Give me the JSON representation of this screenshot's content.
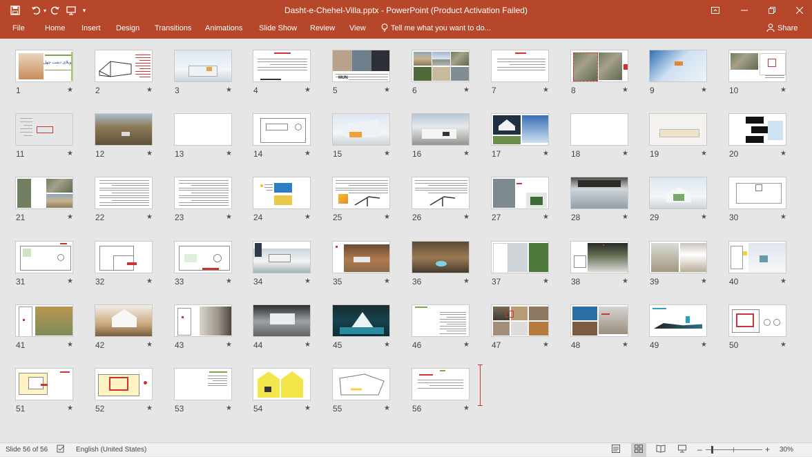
{
  "window": {
    "title": "Dasht-e-Chehel-Villa.pptx - PowerPoint (Product Activation Failed)",
    "accent": "#b7472a"
  },
  "qat": {
    "icons": [
      "save-icon",
      "undo-icon",
      "redo-icon",
      "start-from-beginning-icon",
      "customize-qat-icon"
    ]
  },
  "ribbon": {
    "tabs": [
      "File",
      "Home",
      "Insert",
      "Design",
      "Transitions",
      "Animations",
      "Slide Show",
      "Review",
      "View"
    ],
    "tell_me": "Tell me what you want to do...",
    "share": "Share"
  },
  "slides": {
    "items": [
      {
        "n": "1",
        "star": "★"
      },
      {
        "n": "2",
        "star": "★"
      },
      {
        "n": "3",
        "star": "★"
      },
      {
        "n": "4",
        "star": "★"
      },
      {
        "n": "5",
        "star": "★"
      },
      {
        "n": "6",
        "star": "★"
      },
      {
        "n": "7",
        "star": "★"
      },
      {
        "n": "8",
        "star": "★"
      },
      {
        "n": "9",
        "star": "★"
      },
      {
        "n": "10",
        "star": "★"
      },
      {
        "n": "11",
        "star": "★"
      },
      {
        "n": "12",
        "star": "★"
      },
      {
        "n": "13",
        "star": "★"
      },
      {
        "n": "14",
        "star": "★"
      },
      {
        "n": "15",
        "star": "★"
      },
      {
        "n": "16",
        "star": "★"
      },
      {
        "n": "17",
        "star": "★"
      },
      {
        "n": "18",
        "star": "★"
      },
      {
        "n": "19",
        "star": "★"
      },
      {
        "n": "20",
        "star": "★"
      },
      {
        "n": "21",
        "star": "★"
      },
      {
        "n": "22",
        "star": "★"
      },
      {
        "n": "23",
        "star": "★"
      },
      {
        "n": "24",
        "star": "★"
      },
      {
        "n": "25",
        "star": "★"
      },
      {
        "n": "26",
        "star": "★"
      },
      {
        "n": "27",
        "star": "★"
      },
      {
        "n": "28",
        "star": "★"
      },
      {
        "n": "29",
        "star": "★"
      },
      {
        "n": "30",
        "star": "★"
      },
      {
        "n": "31",
        "star": "★"
      },
      {
        "n": "32",
        "star": "★"
      },
      {
        "n": "33",
        "star": "★"
      },
      {
        "n": "34",
        "star": "★"
      },
      {
        "n": "35",
        "star": "★"
      },
      {
        "n": "36",
        "star": "★"
      },
      {
        "n": "37",
        "star": "★"
      },
      {
        "n": "38",
        "star": "★"
      },
      {
        "n": "39",
        "star": "★"
      },
      {
        "n": "40",
        "star": "★"
      },
      {
        "n": "41",
        "star": "★"
      },
      {
        "n": "42",
        "star": "★"
      },
      {
        "n": "43",
        "star": "★"
      },
      {
        "n": "44",
        "star": "★"
      },
      {
        "n": "45",
        "star": "★"
      },
      {
        "n": "46",
        "star": "★"
      },
      {
        "n": "47",
        "star": "★"
      },
      {
        "n": "48",
        "star": "★"
      },
      {
        "n": "49",
        "star": "★"
      },
      {
        "n": "50",
        "star": "★"
      },
      {
        "n": "51",
        "star": "★"
      },
      {
        "n": "52",
        "star": "★"
      },
      {
        "n": "53",
        "star": "★"
      },
      {
        "n": "54",
        "star": "★"
      },
      {
        "n": "55",
        "star": "★"
      },
      {
        "n": "56",
        "star": "★"
      }
    ],
    "thumb_texts": {
      "s1_title": "ویلای دشت چهل",
      "s5_logo": "MUN"
    },
    "insertion_color": "#c0392b"
  },
  "status": {
    "slide_info": "Slide 56 of 56",
    "language": "English (United States)",
    "zoom": "30%",
    "zoom_minus": "–",
    "zoom_plus": "+",
    "zoom_fraction": 0.3
  }
}
